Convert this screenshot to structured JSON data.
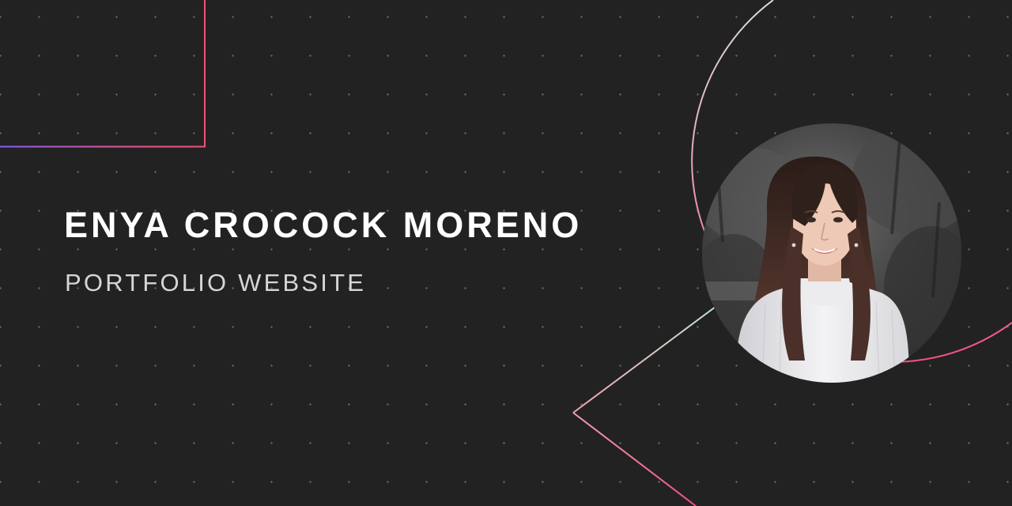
{
  "hero": {
    "name": "ENYA CROCOCK MORENO",
    "subtitle": "PORTFOLIO WEBSITE"
  },
  "portrait": {
    "icon": "person-photo-icon"
  },
  "colors": {
    "background": "#222222",
    "name_text": "#ffffff",
    "subtitle_text": "#d6d6d6",
    "accent_pink": "#f2507b",
    "accent_purple": "#8a5cf5",
    "accent_mint": "#bfe6cf",
    "dot_grid": "#6a6a6a"
  }
}
